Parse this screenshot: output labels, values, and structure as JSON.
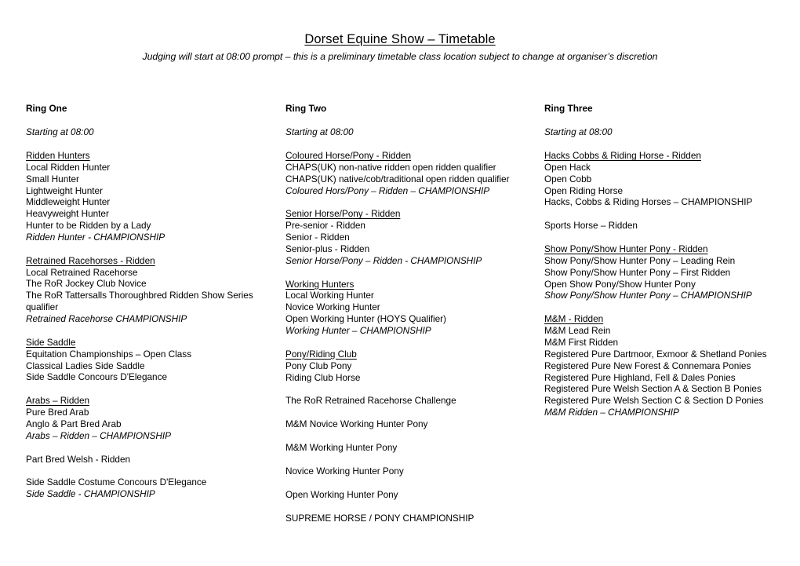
{
  "header": {
    "title": "Dorset Equine Show – Timetable",
    "subtitle": "Judging will start at 08:00 prompt – this is a preliminary timetable class location subject to change at organiser’s discretion"
  },
  "columns": [
    {
      "ring_title": "Ring One",
      "starting": "Starting at 08:00",
      "blocks": [
        {
          "lines": [
            {
              "text": "Ridden Hunters",
              "style": "head"
            },
            {
              "text": "Local Ridden Hunter",
              "style": "plain"
            },
            {
              "text": "Small Hunter",
              "style": "plain"
            },
            {
              "text": "Lightweight Hunter",
              "style": "plain"
            },
            {
              "text": "Middleweight Hunter",
              "style": "plain"
            },
            {
              "text": "Heavyweight Hunter",
              "style": "plain"
            },
            {
              "text": "Hunter to be Ridden by a Lady",
              "style": "plain"
            },
            {
              "text": "Ridden Hunter - CHAMPIONSHIP",
              "style": "ital"
            }
          ]
        },
        {
          "lines": [
            {
              "text": "Retrained Racehorses - Ridden",
              "style": "head"
            },
            {
              "text": "Local Retrained Racehorse",
              "style": "plain"
            },
            {
              "text": "The RoR Jockey Club Novice",
              "style": "plain"
            },
            {
              "text": "The RoR Tattersalls Thoroughbred Ridden Show Series qualifier",
              "style": "plain"
            },
            {
              "text": "Retrained Racehorse CHAMPIONSHIP",
              "style": "ital"
            }
          ]
        },
        {
          "lines": [
            {
              "text": "Side Saddle",
              "style": "head"
            },
            {
              "text": "Equitation Championships – Open Class",
              "style": "plain"
            },
            {
              "text": "Classical Ladies Side Saddle",
              "style": "plain"
            },
            {
              "text": "Side Saddle Concours D'Elegance",
              "style": "plain"
            }
          ]
        },
        {
          "lines": [
            {
              "text": "Arabs – Ridden",
              "style": "head"
            },
            {
              "text": "Pure Bred Arab",
              "style": "plain"
            },
            {
              "text": "Anglo & Part Bred Arab",
              "style": "plain"
            },
            {
              "text": "Arabs – Ridden – CHAMPIONSHIP",
              "style": "ital"
            }
          ]
        },
        {
          "lines": [
            {
              "text": "Part Bred Welsh - Ridden",
              "style": "plain"
            }
          ]
        },
        {
          "lines": [
            {
              "text": "Side Saddle Costume Concours D'Elegance",
              "style": "plain"
            },
            {
              "text": "Side Saddle - CHAMPIONSHIP",
              "style": "ital"
            }
          ]
        }
      ]
    },
    {
      "ring_title": "Ring Two",
      "starting": "Starting at 08:00",
      "blocks": [
        {
          "lines": [
            {
              "text": "Coloured Horse/Pony - Ridden",
              "style": "head"
            },
            {
              "text": "CHAPS(UK) non-native ridden open ridden qualifier",
              "style": "plain"
            },
            {
              "text": "CHAPS(UK) native/cob/traditional open ridden qualifier",
              "style": "plain"
            },
            {
              "text": "Coloured Hors/Pony – Ridden – CHAMPIONSHIP",
              "style": "ital"
            }
          ]
        },
        {
          "lines": [
            {
              "text": "Senior Horse/Pony - Ridden",
              "style": "head"
            },
            {
              "text": "Pre-senior - Ridden",
              "style": "plain"
            },
            {
              "text": "Senior - Ridden",
              "style": "plain"
            },
            {
              "text": "Senior-plus - Ridden",
              "style": "plain"
            },
            {
              "text": "Senior Horse/Pony – Ridden - CHAMPIONSHIP",
              "style": "ital"
            }
          ]
        },
        {
          "lines": [
            {
              "text": "Working Hunters",
              "style": "head"
            },
            {
              "text": "Local Working Hunter",
              "style": "plain"
            },
            {
              "text": "Novice Working Hunter",
              "style": "plain"
            },
            {
              "text": "Open Working Hunter (HOYS Qualifier)",
              "style": "plain"
            },
            {
              "text": "Working Hunter – CHAMPIONSHIP",
              "style": "ital"
            }
          ]
        },
        {
          "lines": [
            {
              "text": "Pony/Riding Club",
              "style": "head"
            },
            {
              "text": "Pony Club Pony",
              "style": "plain"
            },
            {
              "text": "Riding Club Horse",
              "style": "plain"
            }
          ]
        },
        {
          "lines": [
            {
              "text": "The RoR Retrained Racehorse Challenge",
              "style": "plain"
            }
          ]
        },
        {
          "lines": [
            {
              "text": "M&M Novice Working Hunter Pony",
              "style": "plain"
            }
          ]
        },
        {
          "lines": [
            {
              "text": "M&M Working Hunter Pony",
              "style": "plain"
            }
          ]
        },
        {
          "lines": [
            {
              "text": "Novice Working Hunter Pony",
              "style": "plain"
            }
          ]
        },
        {
          "lines": [
            {
              "text": "Open Working Hunter Pony",
              "style": "plain"
            }
          ]
        },
        {
          "lines": [
            {
              "text": "SUPREME HORSE / PONY CHAMPIONSHIP",
              "style": "plain"
            }
          ]
        }
      ]
    },
    {
      "ring_title": "Ring Three",
      "starting": "Starting at 08:00",
      "blocks": [
        {
          "lines": [
            {
              "text": "Hacks Cobbs & Riding Horse - Ridden",
              "style": "head"
            },
            {
              "text": "Open Hack",
              "style": "plain"
            },
            {
              "text": "Open Cobb",
              "style": "plain"
            },
            {
              "text": "Open Riding Horse",
              "style": "plain"
            },
            {
              "text": "Hacks, Cobbs & Riding Horses – CHAMPIONSHIP",
              "style": "plain"
            }
          ]
        },
        {
          "lines": [
            {
              "text": "Sports Horse – Ridden",
              "style": "plain"
            }
          ]
        },
        {
          "lines": [
            {
              "text": "Show Pony/Show Hunter Pony - Ridden",
              "style": "head"
            },
            {
              "text": "Show Pony/Show Hunter Pony – Leading Rein",
              "style": "plain"
            },
            {
              "text": "Show Pony/Show Hunter Pony – First Ridden",
              "style": "plain"
            },
            {
              "text": "Open Show Pony/Show Hunter Pony",
              "style": "plain"
            },
            {
              "text": "Show Pony/Show Hunter Pony – CHAMPIONSHIP",
              "style": "ital"
            }
          ]
        },
        {
          "lines": [
            {
              "text": "M&M - Ridden",
              "style": "head"
            },
            {
              "text": "M&M Lead Rein",
              "style": "plain"
            },
            {
              "text": "M&M First Ridden",
              "style": "plain"
            },
            {
              "text": "Registered Pure Dartmoor, Exmoor & Shetland Ponies",
              "style": "plain"
            },
            {
              "text": "Registered Pure New Forest & Connemara Ponies",
              "style": "plain"
            },
            {
              "text": "Registered Pure Highland, Fell & Dales Ponies",
              "style": "plain"
            },
            {
              "text": "Registered Pure Welsh Section A & Section B Ponies",
              "style": "plain"
            },
            {
              "text": "Registered Pure Welsh Section C & Section D Ponies",
              "style": "plain"
            },
            {
              "text": "M&M Ridden – CHAMPIONSHIP",
              "style": "ital"
            }
          ]
        }
      ]
    }
  ]
}
